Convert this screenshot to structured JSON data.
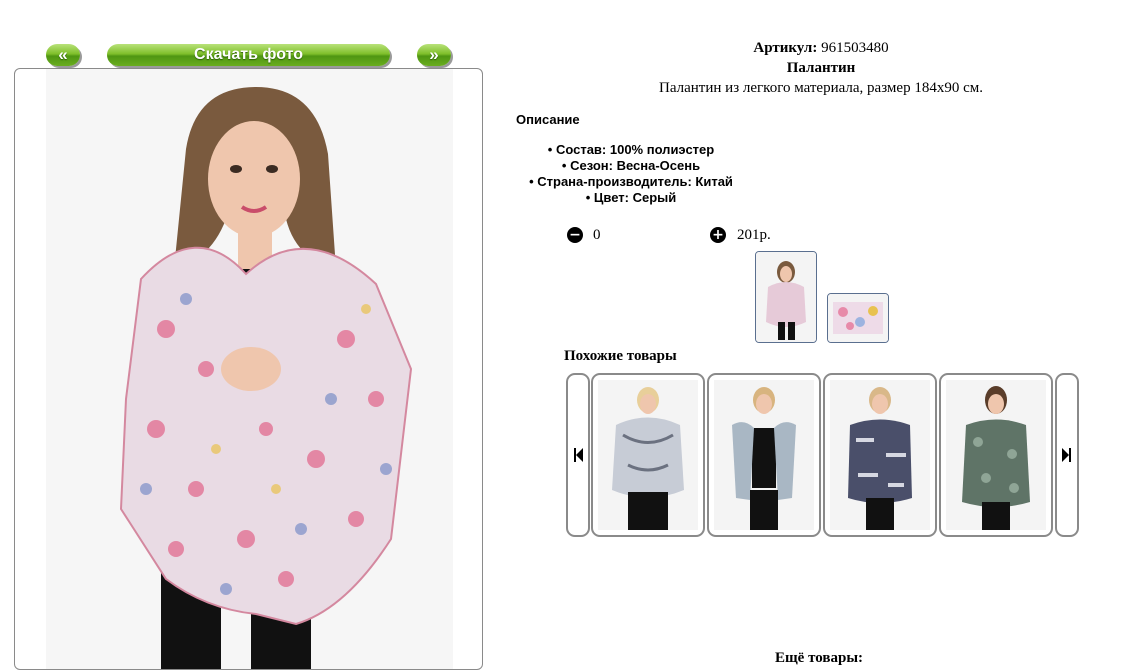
{
  "nav": {
    "prev_label": "«",
    "download_label": "Скачать фото",
    "next_label": "»"
  },
  "product": {
    "article_label": "Артикул:",
    "article_value": "961503480",
    "name": "Палантин",
    "subtitle": "Палантин из легкого материала, размер 184х90 см."
  },
  "description": {
    "title": "Описание",
    "items": [
      "Состав: 100% полиэстер",
      "Сезон: Весна-Осень",
      "Страна-производитель: Китай",
      "Цвет: Серый"
    ]
  },
  "cart": {
    "quantity": "0",
    "price": "201р."
  },
  "similar": {
    "title": "Похожие товары"
  },
  "footer": {
    "more_text": "Ещё товары:"
  },
  "colors": {
    "button_green": "#6aad1f",
    "frame_border": "#8a8a8a",
    "thumb_border": "#5a6f8f"
  },
  "icons": {
    "minus": "minus-circle-icon",
    "plus": "plus-circle-icon",
    "first": "skip-back-icon",
    "last": "skip-forward-icon"
  }
}
